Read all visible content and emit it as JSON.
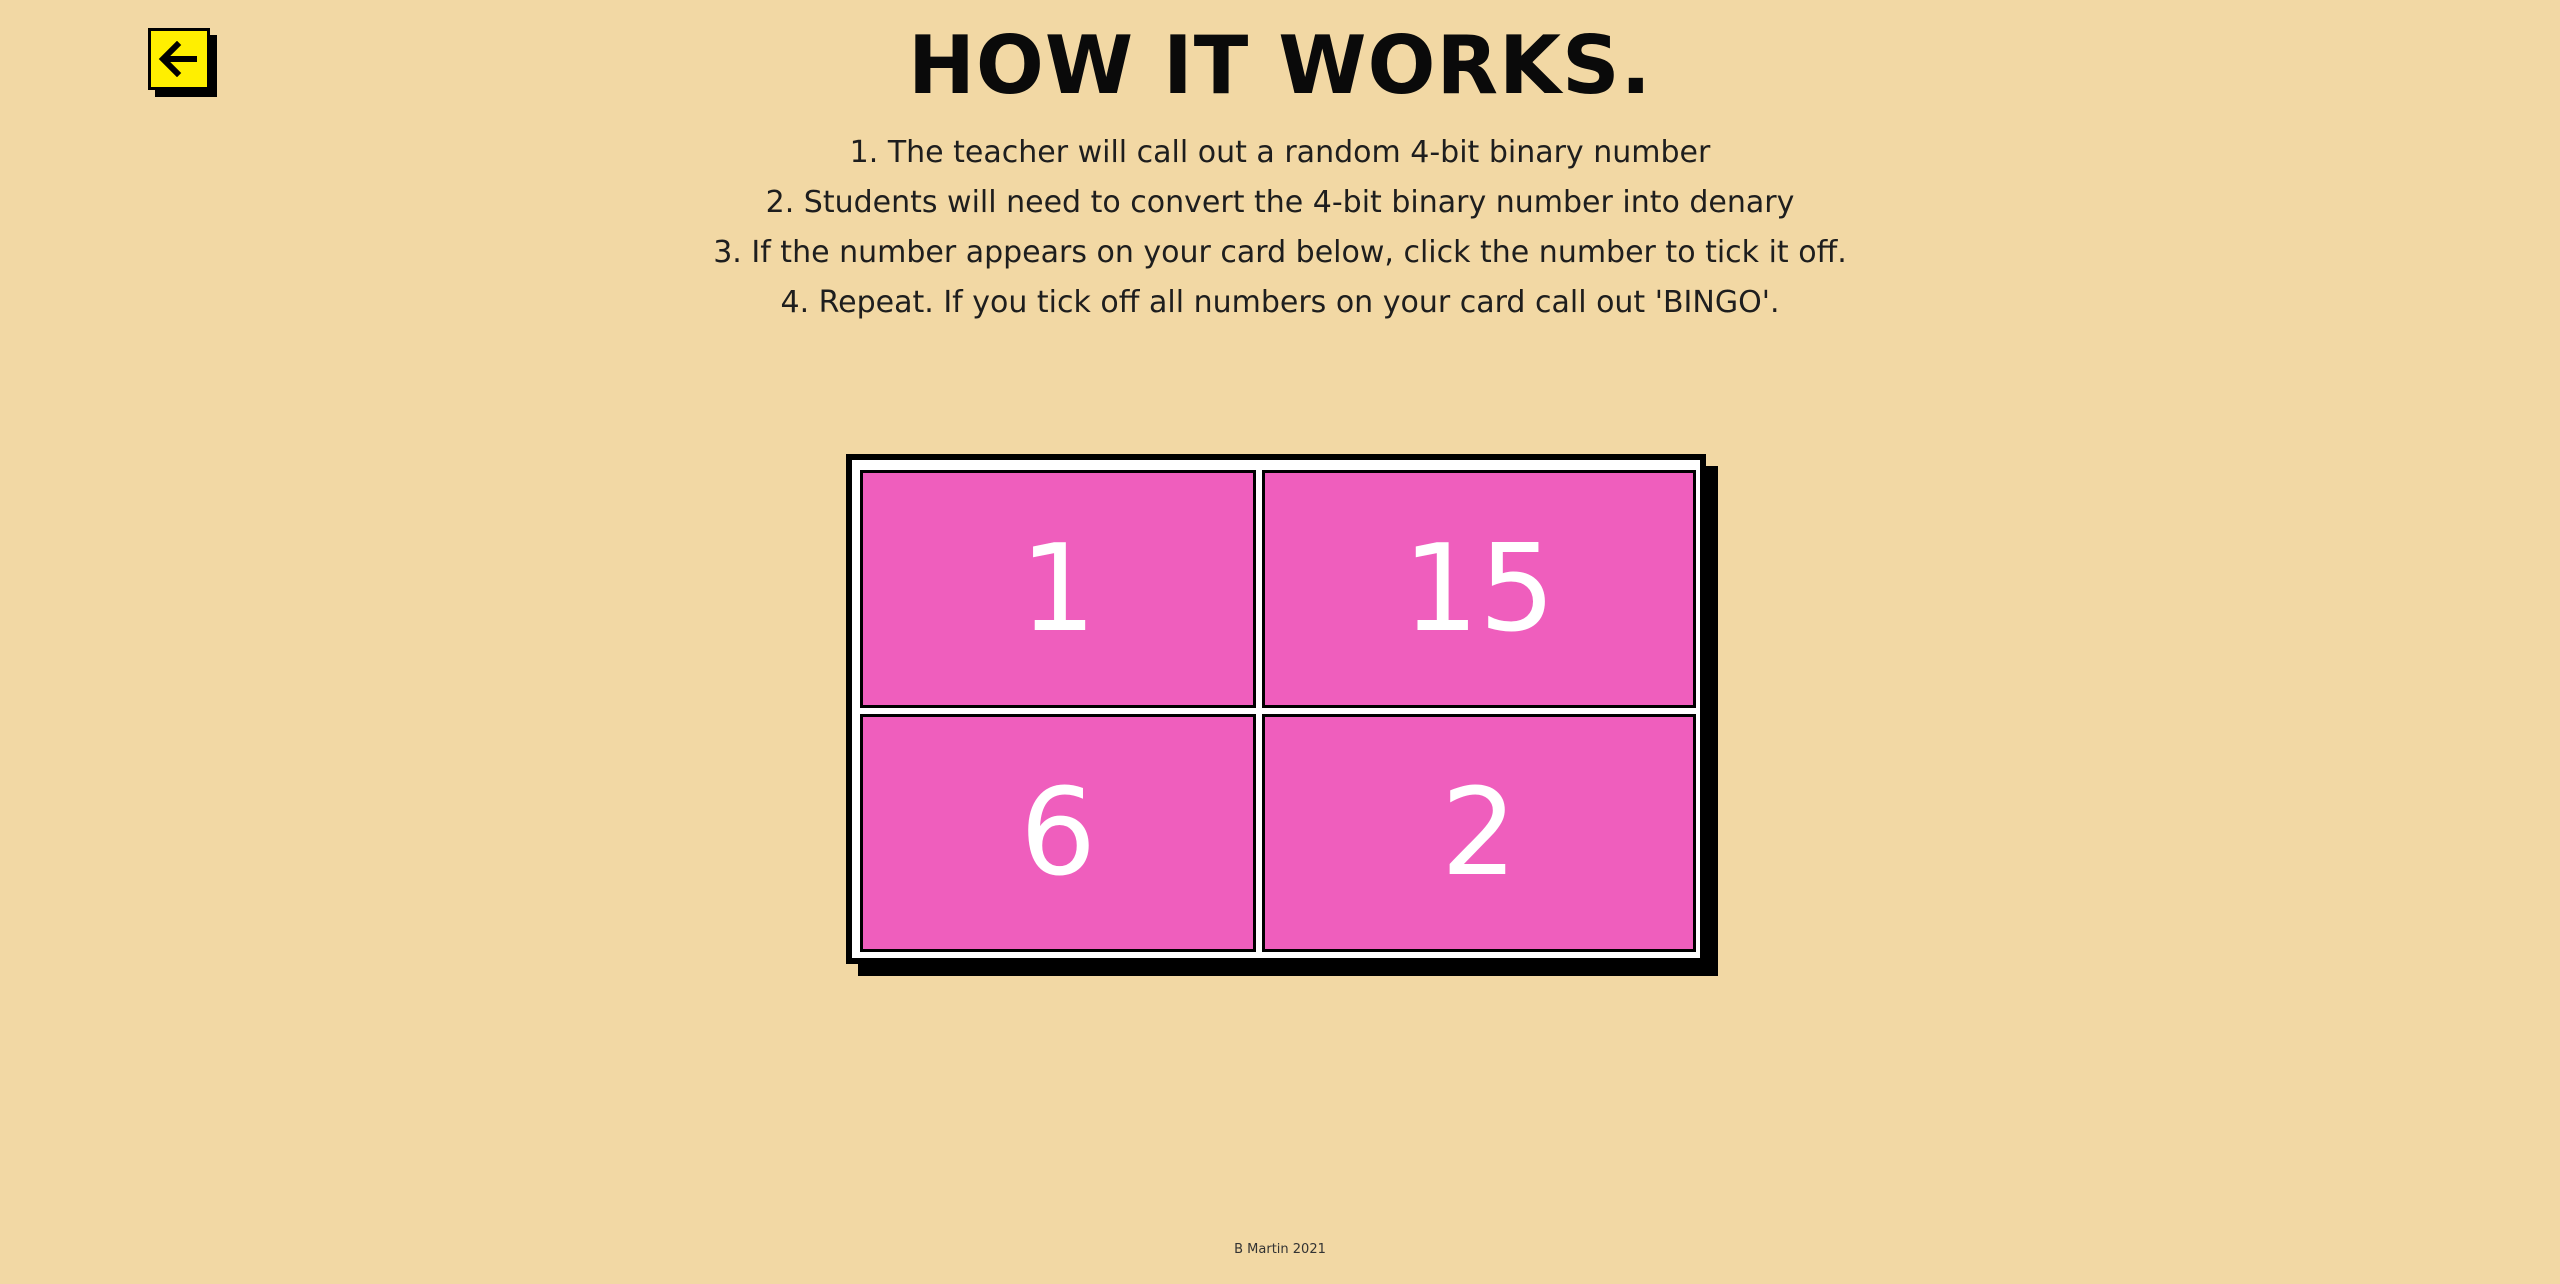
{
  "header": {
    "title": "HOW IT WORKS."
  },
  "back_button": {
    "icon": "arrow-left-icon",
    "color": "#ffef00"
  },
  "instructions": [
    "1. The teacher will call out a random 4-bit binary number",
    "2. Students will need to convert the 4-bit binary number into denary",
    "3. If the number appears on your card below, click the number to tick it off.",
    "4. Repeat. If you tick off all numbers on your card call out 'BINGO'."
  ],
  "bingo_card": {
    "cell_color": "#ef5ebd",
    "numbers": [
      "1",
      "15",
      "6",
      "2"
    ]
  },
  "footer": {
    "credit": "B Martin 2021"
  }
}
